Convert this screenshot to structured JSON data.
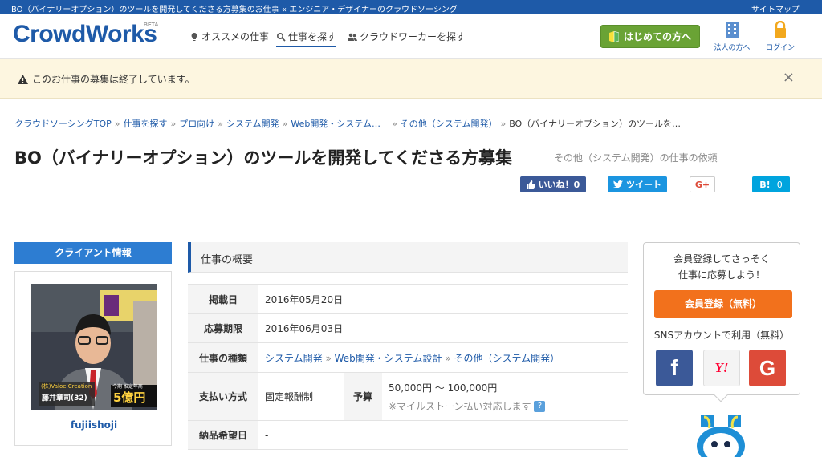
{
  "topbar": {
    "tagline": "BO（バイナリーオプション）のツールを開発してくださる方募集のお仕事 « エンジニア・デザイナーのクラウドソーシング",
    "sitemap": "サイトマップ"
  },
  "header": {
    "logo": "CrowdWorks",
    "logo_beta": "BETA",
    "nav": [
      {
        "label": "オススメの仕事"
      },
      {
        "label": "仕事を探す"
      },
      {
        "label": "クラウドワーカーを探す"
      }
    ],
    "first_button": "はじめての方へ",
    "corporate": "法人の方へ",
    "login": "ログイン"
  },
  "notice": {
    "message": "このお仕事の募集は終了しています。",
    "close": "×"
  },
  "breadcrumb": [
    "クラウドソーシングTOP",
    "仕事を探す",
    "プロ向け",
    "システム開発",
    "Web開発・システム…",
    "その他（システム開発）",
    "BO（バイナリーオプション）のツールを…"
  ],
  "breadcrumb_sep": "»",
  "job": {
    "title": "BO（バイナリーオプション）のツールを開発してくださる方募集",
    "subtitle": "その他（システム開発）の仕事の依頼"
  },
  "share": {
    "fb_like": "いいね！0",
    "tweet": "ツイート",
    "gplus": "G+",
    "hatena_label": "B!",
    "hatena_count": "0"
  },
  "client": {
    "heading": "クライアント情報",
    "name": "fujiishoji",
    "photo_text": {
      "company": "(株)Valoe Creation",
      "person": "藤井章司(32)",
      "amount": "5億円",
      "caption": "今期 推定年商"
    }
  },
  "overview": {
    "heading": "仕事の概要",
    "rows": {
      "posted": {
        "label": "掲載日",
        "value": "2016年05月20日"
      },
      "deadline": {
        "label": "応募期限",
        "value": "2016年06月03日"
      },
      "type": {
        "label": "仕事の種類",
        "cat1": "システム開発",
        "cat2": "Web開発・システム設計",
        "cat3": "その他（システム開発）",
        "sep": "»"
      },
      "payment": {
        "label": "支払い方式",
        "value": "固定報酬制"
      },
      "budget": {
        "label": "予算",
        "value": "50,000円 〜 100,000円",
        "note": "※マイルストーン払い対応します",
        "help": "?"
      },
      "delivery": {
        "label": "納品希望日",
        "value": "-"
      }
    }
  },
  "register": {
    "intro_line1": "会員登録してさっそく",
    "intro_line2": "仕事に応募しよう！",
    "button": "会員登録（無料）",
    "sns_label": "SNSアカウントで利用（無料）",
    "facebook": "f",
    "yahoo": "Y!",
    "google": "G"
  },
  "colors": {
    "brand_blue": "#1e5aa8",
    "green": "#6aa335",
    "orange": "#f2711c",
    "notice_bg": "#fdf6e0"
  }
}
